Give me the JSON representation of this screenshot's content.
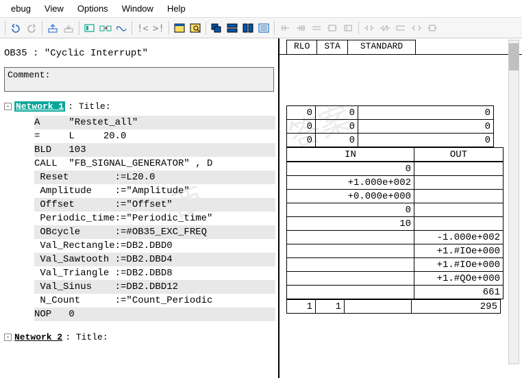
{
  "menu": {
    "items": [
      "ebug",
      "View",
      "Options",
      "Window",
      "Help"
    ]
  },
  "toolbar": {
    "icons": [
      "undo",
      "redo",
      "upload",
      "download",
      "bracket",
      "next",
      "var-table",
      "left-exclaim",
      "right-exclaim",
      "window",
      "find-window",
      "cascade",
      "tile-h",
      "tile-v",
      "list",
      "conn1",
      "conn2",
      "conn3",
      "conn4",
      "coil",
      "contact-open",
      "contact-close",
      "coil-neg",
      "branch"
    ]
  },
  "ob": {
    "name": "OB35",
    "title": "\"Cyclic Interrupt\""
  },
  "comment": {
    "label": "Comment:",
    "text": ""
  },
  "network1": {
    "label": "Network 1",
    "title_lbl": ": Title:"
  },
  "code": {
    "rows": [
      {
        "grey": true,
        "text": "A     \"Restet_all\""
      },
      {
        "grey": false,
        "text": "=     L     20.0"
      },
      {
        "grey": true,
        "text": "BLD   103"
      },
      {
        "grey": false,
        "text": "CALL  \"FB_SIGNAL_GENERATOR\" , D"
      },
      {
        "grey": true,
        "text": " Reset        :=L20.0"
      },
      {
        "grey": false,
        "text": " Amplitude    :=\"Amplitude\""
      },
      {
        "grey": true,
        "text": " Offset       :=\"Offset\""
      },
      {
        "grey": false,
        "text": " Periodic_time:=\"Periodic_time\""
      },
      {
        "grey": true,
        "text": " OBcycle      :=#OB35_EXC_FREQ"
      },
      {
        "grey": false,
        "text": " Val_Rectangle:=DB2.DBD0"
      },
      {
        "grey": true,
        "text": " Val_Sawtooth :=DB2.DBD4"
      },
      {
        "grey": false,
        "text": " Val_Triangle :=DB2.DBD8"
      },
      {
        "grey": true,
        "text": " Val_Sinus    :=DB2.DBD12"
      },
      {
        "grey": false,
        "text": " N_Count      :=\"Count_Periodic"
      },
      {
        "grey": true,
        "text": "NOP   0"
      }
    ]
  },
  "network2": {
    "label": "Network 2",
    "title_lbl": ": Title:"
  },
  "right": {
    "tabs": [
      "RLO",
      "STA",
      "STANDARD"
    ],
    "top3": [
      [
        "0",
        "0",
        "0"
      ],
      [
        "0",
        "0",
        "0"
      ],
      [
        "0",
        "0",
        "0"
      ]
    ],
    "io_hdr": [
      "IN",
      "OUT"
    ],
    "io_rows": [
      [
        "0",
        ""
      ],
      [
        "+1.000e+002",
        ""
      ],
      [
        "+0.000e+000",
        ""
      ],
      [
        "0",
        ""
      ],
      [
        "10",
        ""
      ],
      [
        "",
        "-1.000e+002"
      ],
      [
        "",
        "+1.#IOe+000"
      ],
      [
        "",
        "+1.#IOe+000"
      ],
      [
        "",
        "+1.#QOe+000"
      ],
      [
        "",
        "661"
      ]
    ],
    "bottom": [
      "1",
      "1",
      "",
      "295"
    ]
  }
}
